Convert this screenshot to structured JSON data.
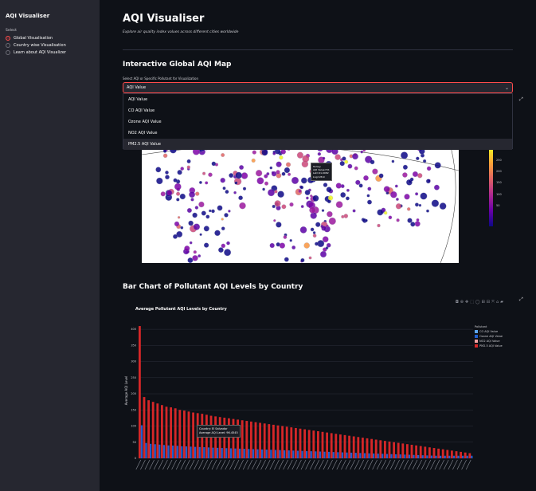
{
  "sidebar": {
    "title": "AQI Visualiser",
    "select_label": "Select",
    "options": [
      "Global Visualisation",
      "Country wise Visualisation",
      "Learn about AQI Visualizer"
    ],
    "selected_index": 0
  },
  "main": {
    "title": "AQI Visualiser",
    "subtitle": "Explore air quality index values across different cities worldwide",
    "map_section": {
      "heading": "Interactive Global AQI Map",
      "select_label": "Select AQI or Specific Pollutant for Visualization",
      "select_value": "AQI Value",
      "dropdown_options": [
        "AQI Value",
        "CO AQI Value",
        "Ozone AQI Value",
        "NO2 AQI Value",
        "PM2.5 AQI Value"
      ],
      "highlighted_option_index": 4,
      "tooltip": [
        "Turkey",
        "AQI Value=51",
        "Lat=41.0082",
        "Lng=28.9"
      ],
      "colorbar_ticks": [
        "300",
        "250",
        "200",
        "150",
        "100",
        "50"
      ]
    },
    "bar_section": {
      "heading": "Bar Chart of Pollutant AQI Levels by Country",
      "tooltip": [
        "Country: El Salvador",
        "Average AQI Level: 96.4545"
      ]
    }
  },
  "chart_data": {
    "type": "bar",
    "title": "Average Pollutant AQI Levels by Country",
    "xlabel": "",
    "ylabel": "Average AQI Level",
    "ylim": [
      0,
      420
    ],
    "y_ticks": [
      0,
      50,
      100,
      150,
      200,
      250,
      300,
      350,
      400
    ],
    "legend_title": "Pollutant",
    "legend_position": "top-right",
    "series": [
      {
        "name": "CO AQI Value",
        "color": "#5ea7f2"
      },
      {
        "name": "Ozone AQI Value",
        "color": "#1f5fd1"
      },
      {
        "name": "NO2 AQI Value",
        "color": "#f2a2a2"
      },
      {
        "name": "PM2.5 AQI Value",
        "color": "#d62728"
      }
    ],
    "pm25_profile": [
      410,
      190,
      180,
      175,
      170,
      165,
      160,
      158,
      155,
      150,
      148,
      145,
      142,
      140,
      138,
      135,
      132,
      130,
      128,
      126,
      124,
      122,
      120,
      118,
      116,
      114,
      112,
      110,
      108,
      106,
      104,
      102,
      100,
      98,
      96,
      94,
      92,
      90,
      88,
      86,
      84,
      82,
      80,
      78,
      76,
      74,
      72,
      70,
      68,
      66,
      64,
      62,
      60,
      58,
      56,
      54,
      52,
      50,
      48,
      46,
      44,
      42,
      40,
      38,
      36,
      34,
      32,
      30,
      28,
      26,
      24,
      22,
      20,
      18,
      16
    ],
    "grid": true
  }
}
